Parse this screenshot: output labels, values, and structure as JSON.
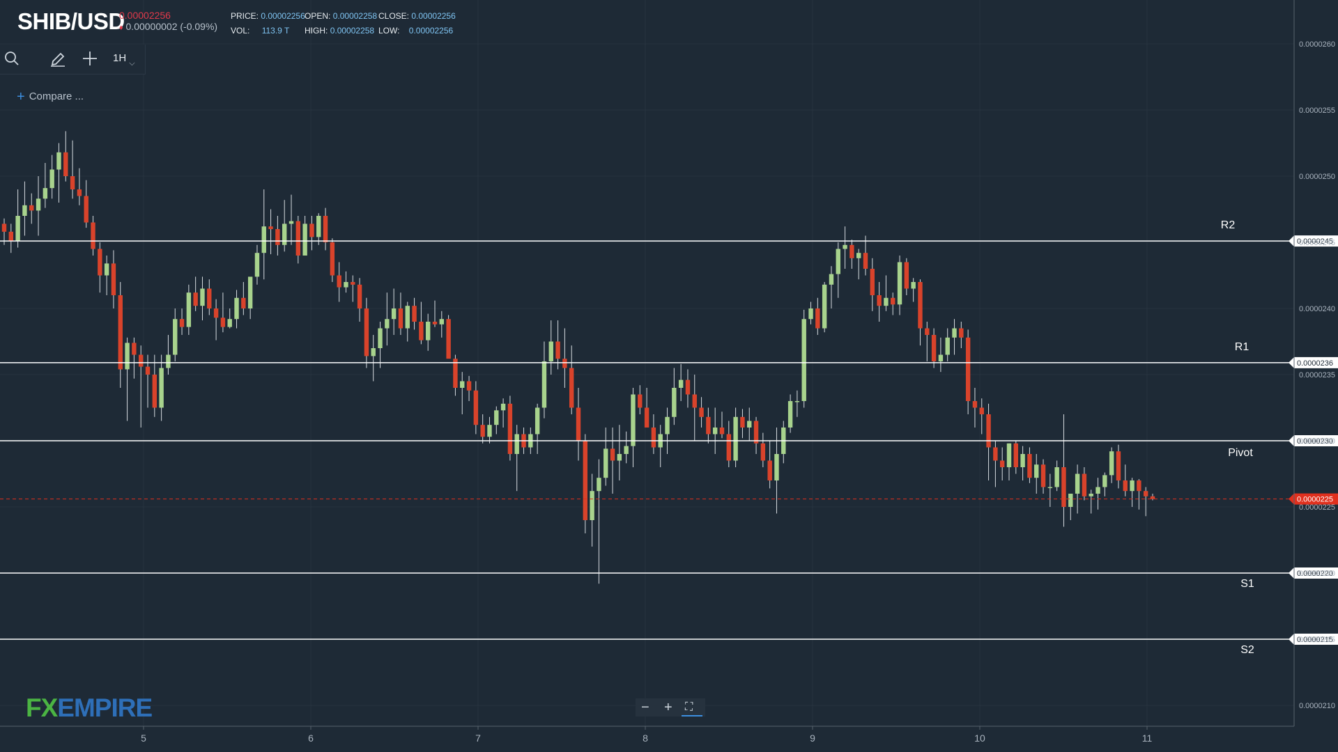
{
  "header": {
    "symbol": "SHIB/USD",
    "last_price": "0.00002256",
    "change_arrow": "♦",
    "change": "0.00000002 (-0.09%)",
    "ohlc": {
      "price_label": "PRICE:",
      "price": "0.00002256",
      "open_label": "OPEN:",
      "open": "0.00002258",
      "close_label": "CLOSE:",
      "close": "0.00002256",
      "vol_label": "VOL:",
      "vol": "113.9 T",
      "high_label": "HIGH:",
      "high": "0.00002258",
      "low_label": "LOW:",
      "low": "0.00002256"
    }
  },
  "toolbar": {
    "icons": [
      "search-icon",
      "pencil-icon",
      "crosshair-icon"
    ],
    "timeframe": "1H",
    "compare_label": "Compare ..."
  },
  "logo": {
    "fx": "FX",
    "empire": "EMPIRE"
  },
  "zoom_controls": {
    "minus": "−",
    "plus": "+",
    "fullscreen": "⛶"
  },
  "colors": {
    "background": "#1e2a36",
    "up": "#a8d38d",
    "down": "#d9432b",
    "level_line": "#ffffff",
    "current_price": "#e0301e",
    "axis_text": "#aab4bf"
  },
  "chart_data": {
    "type": "candlestick",
    "title": "",
    "x_ticks": [
      "5",
      "6",
      "7",
      "8",
      "9",
      "10",
      "11"
    ],
    "y_ticks": [
      "0.0000210",
      "0.0000215",
      "0.0000220",
      "0.0000225",
      "0.0000230",
      "0.0000235",
      "0.0000240",
      "0.0000245",
      "0.0000250",
      "0.0000255",
      "0.0000260"
    ],
    "ylim": [
      2.085e-05,
      2.632e-05
    ],
    "levels": [
      {
        "name": "R2",
        "value": 2.451e-05,
        "label": "0.0000245"
      },
      {
        "name": "R1",
        "value": 2.359e-05,
        "label": "0.0000236"
      },
      {
        "name": "Pivot",
        "value": 2.3e-05,
        "label": "0.0000230"
      },
      {
        "name": "S1",
        "value": 2.2e-05,
        "label": "0.0000220"
      },
      {
        "name": "S2",
        "value": 2.15e-05,
        "label": "0.0000215"
      }
    ],
    "current_price": {
      "value": 2.256e-05,
      "label": "0.0000225"
    },
    "grid": true,
    "candles_ohlc": [
      [
        2.464e-05,
        2.468e-05,
        2.448e-05,
        2.458e-05
      ],
      [
        2.458e-05,
        2.464e-05,
        2.442e-05,
        2.451e-05
      ],
      [
        2.451e-05,
        2.49e-05,
        2.446e-05,
        2.47e-05
      ],
      [
        2.47e-05,
        2.496e-05,
        2.455e-05,
        2.478e-05
      ],
      [
        2.478e-05,
        2.487e-05,
        2.464e-05,
        2.474e-05
      ],
      [
        2.474e-05,
        2.5e-05,
        2.455e-05,
        2.483e-05
      ],
      [
        2.483e-05,
        2.51e-05,
        2.476e-05,
        2.491e-05
      ],
      [
        2.491e-05,
        2.516e-05,
        2.483e-05,
        2.505e-05
      ],
      [
        2.505e-05,
        2.525e-05,
        2.48e-05,
        2.518e-05
      ],
      [
        2.518e-05,
        2.534e-05,
        2.496e-05,
        2.5e-05
      ],
      [
        2.5e-05,
        2.527e-05,
        2.483e-05,
        2.49e-05
      ],
      [
        2.49e-05,
        2.506e-05,
        2.478e-05,
        2.485e-05
      ],
      [
        2.485e-05,
        2.497e-05,
        2.461e-05,
        2.465e-05
      ],
      [
        2.465e-05,
        2.47e-05,
        2.44e-05,
        2.445e-05
      ],
      [
        2.445e-05,
        2.45e-05,
        2.412e-05,
        2.425e-05
      ],
      [
        2.425e-05,
        2.44e-05,
        2.41e-05,
        2.434e-05
      ],
      [
        2.434e-05,
        2.444e-05,
        2.4e-05,
        2.41e-05
      ],
      [
        2.41e-05,
        2.42e-05,
        2.34e-05,
        2.354e-05
      ],
      [
        2.354e-05,
        2.378e-05,
        2.315e-05,
        2.374e-05
      ],
      [
        2.374e-05,
        2.378e-05,
        2.347e-05,
        2.365e-05
      ],
      [
        2.365e-05,
        2.372e-05,
        2.31e-05,
        2.356e-05
      ],
      [
        2.356e-05,
        2.365e-05,
        2.325e-05,
        2.35e-05
      ],
      [
        2.35e-05,
        2.365e-05,
        2.318e-05,
        2.325e-05
      ],
      [
        2.325e-05,
        2.365e-05,
        2.315e-05,
        2.355e-05
      ],
      [
        2.355e-05,
        2.38e-05,
        2.35e-05,
        2.365e-05
      ],
      [
        2.365e-05,
        2.4e-05,
        2.36e-05,
        2.392e-05
      ],
      [
        2.392e-05,
        2.4e-05,
        2.38e-05,
        2.386e-05
      ],
      [
        2.386e-05,
        2.418e-05,
        2.38e-05,
        2.412e-05
      ],
      [
        2.412e-05,
        2.424e-05,
        2.398e-05,
        2.402e-05
      ],
      [
        2.402e-05,
        2.424e-05,
        2.391e-05,
        2.415e-05
      ],
      [
        2.415e-05,
        2.422e-05,
        2.395e-05,
        2.4e-05
      ],
      [
        2.4e-05,
        2.407e-05,
        2.376e-05,
        2.393e-05
      ],
      [
        2.393e-05,
        2.412e-05,
        2.382e-05,
        2.386e-05
      ],
      [
        2.386e-05,
        2.4e-05,
        2.385e-05,
        2.392e-05
      ],
      [
        2.392e-05,
        2.414e-05,
        2.385e-05,
        2.408e-05
      ],
      [
        2.408e-05,
        2.42e-05,
        2.395e-05,
        2.4e-05
      ],
      [
        2.4e-05,
        2.422e-05,
        2.392e-05,
        2.424e-05
      ],
      [
        2.424e-05,
        2.448e-05,
        2.418e-05,
        2.442e-05
      ],
      [
        2.442e-05,
        2.49e-05,
        2.422e-05,
        2.462e-05
      ],
      [
        2.462e-05,
        2.475e-05,
        2.441e-05,
        2.46e-05
      ],
      [
        2.46e-05,
        2.47e-05,
        2.44e-05,
        2.448e-05
      ],
      [
        2.448e-05,
        2.482e-05,
        2.443e-05,
        2.464e-05
      ],
      [
        2.464e-05,
        2.486e-05,
        2.448e-05,
        2.466e-05
      ],
      [
        2.466e-05,
        2.47e-05,
        2.434e-05,
        2.44e-05
      ],
      [
        2.44e-05,
        2.47e-05,
        2.44e-05,
        2.464e-05
      ],
      [
        2.464e-05,
        2.47e-05,
        2.444e-05,
        2.454e-05
      ],
      [
        2.454e-05,
        2.472e-05,
        2.448e-05,
        2.47e-05
      ],
      [
        2.47e-05,
        2.476e-05,
        2.444e-05,
        2.45e-05
      ],
      [
        2.45e-05,
        2.453e-05,
        2.42e-05,
        2.425e-05
      ],
      [
        2.425e-05,
        2.435e-05,
        2.405e-05,
        2.416e-05
      ],
      [
        2.416e-05,
        2.428e-05,
        2.412e-05,
        2.42e-05
      ],
      [
        2.42e-05,
        2.425e-05,
        2.405e-05,
        2.418e-05
      ],
      [
        2.418e-05,
        2.423e-05,
        2.39e-05,
        2.4e-05
      ],
      [
        2.4e-05,
        2.408e-05,
        2.355e-05,
        2.364e-05
      ],
      [
        2.364e-05,
        2.38e-05,
        2.345e-05,
        2.37e-05
      ],
      [
        2.37e-05,
        2.39e-05,
        2.355e-05,
        2.385e-05
      ],
      [
        2.385e-05,
        2.412e-05,
        2.372e-05,
        2.392e-05
      ],
      [
        2.392e-05,
        2.415e-05,
        2.38e-05,
        2.4e-05
      ],
      [
        2.4e-05,
        2.412e-05,
        2.38e-05,
        2.385e-05
      ],
      [
        2.385e-05,
        2.405e-05,
        2.375e-05,
        2.402e-05
      ],
      [
        2.402e-05,
        2.408e-05,
        2.384e-05,
        2.39e-05
      ],
      [
        2.39e-05,
        2.405e-05,
        2.373e-05,
        2.376e-05
      ],
      [
        2.376e-05,
        2.396e-05,
        2.368e-05,
        2.39e-05
      ],
      [
        2.39e-05,
        2.406e-05,
        2.386e-05,
        2.388e-05
      ],
      [
        2.388e-05,
        2.398e-05,
        2.378e-05,
        2.392e-05
      ],
      [
        2.392e-05,
        2.395e-05,
        2.363e-05,
        2.362e-05
      ],
      [
        2.362e-05,
        2.365e-05,
        2.334e-05,
        2.34e-05
      ],
      [
        2.34e-05,
        2.352e-05,
        2.32e-05,
        2.345e-05
      ],
      [
        2.345e-05,
        2.349e-05,
        2.33e-05,
        2.338e-05
      ],
      [
        2.338e-05,
        2.345e-05,
        2.305e-05,
        2.312e-05
      ],
      [
        2.312e-05,
        2.32e-05,
        2.298e-05,
        2.303e-05
      ],
      [
        2.303e-05,
        2.318e-05,
        2.298e-05,
        2.312e-05
      ],
      [
        2.312e-05,
        2.326e-05,
        2.305e-05,
        2.323e-05
      ],
      [
        2.323e-05,
        2.332e-05,
        2.31e-05,
        2.328e-05
      ],
      [
        2.328e-05,
        2.334e-05,
        2.285e-05,
        2.29e-05
      ],
      [
        2.29e-05,
        2.312e-05,
        2.262e-05,
        2.305e-05
      ],
      [
        2.305e-05,
        2.31e-05,
        2.29e-05,
        2.295e-05
      ],
      [
        2.295e-05,
        2.31e-05,
        2.29e-05,
        2.305e-05
      ],
      [
        2.305e-05,
        2.328e-05,
        2.29e-05,
        2.325e-05
      ],
      [
        2.325e-05,
        2.375e-05,
        2.317e-05,
        2.36e-05
      ],
      [
        2.36e-05,
        2.391e-05,
        2.35e-05,
        2.375e-05
      ],
      [
        2.375e-05,
        2.391e-05,
        2.354e-05,
        2.362e-05
      ],
      [
        2.362e-05,
        2.385e-05,
        2.34e-05,
        2.355e-05
      ],
      [
        2.355e-05,
        2.372e-05,
        2.32e-05,
        2.325e-05
      ],
      [
        2.325e-05,
        2.34e-05,
        2.285e-05,
        2.3e-05
      ],
      [
        2.3e-05,
        2.305e-05,
        2.23e-05,
        2.24e-05
      ],
      [
        2.24e-05,
        2.275e-05,
        2.22e-05,
        2.262e-05
      ],
      [
        2.262e-05,
        2.286e-05,
        2.192e-05,
        2.272e-05
      ],
      [
        2.272e-05,
        2.31e-05,
        2.266e-05,
        2.294e-05
      ],
      [
        2.294e-05,
        2.31e-05,
        2.26e-05,
        2.285e-05
      ],
      [
        2.285e-05,
        2.312e-05,
        2.27e-05,
        2.29e-05
      ],
      [
        2.29e-05,
        2.307e-05,
        2.283e-05,
        2.296e-05
      ],
      [
        2.296e-05,
        2.34e-05,
        2.28e-05,
        2.335e-05
      ],
      [
        2.335e-05,
        2.342e-05,
        2.32e-05,
        2.325e-05
      ],
      [
        2.325e-05,
        2.34e-05,
        2.312e-05,
        2.31e-05
      ],
      [
        2.31e-05,
        2.32e-05,
        2.29e-05,
        2.295e-05
      ],
      [
        2.295e-05,
        2.312e-05,
        2.28e-05,
        2.305e-05
      ],
      [
        2.305e-05,
        2.325e-05,
        2.29e-05,
        2.318e-05
      ],
      [
        2.318e-05,
        2.355e-05,
        2.312e-05,
        2.34e-05
      ],
      [
        2.34e-05,
        2.358e-05,
        2.33e-05,
        2.346e-05
      ],
      [
        2.346e-05,
        2.354e-05,
        2.325e-05,
        2.335e-05
      ],
      [
        2.335e-05,
        2.35e-05,
        2.3e-05,
        2.325e-05
      ],
      [
        2.325e-05,
        2.333e-05,
        2.31e-05,
        2.318e-05
      ],
      [
        2.318e-05,
        2.325e-05,
        2.298e-05,
        2.305e-05
      ],
      [
        2.305e-05,
        2.325e-05,
        2.29e-05,
        2.31e-05
      ],
      [
        2.31e-05,
        2.322e-05,
        2.302e-05,
        2.305e-05
      ],
      [
        2.305e-05,
        2.315e-05,
        2.28e-05,
        2.285e-05
      ],
      [
        2.285e-05,
        2.325e-05,
        2.28e-05,
        2.318e-05
      ],
      [
        2.318e-05,
        2.324e-05,
        2.302e-05,
        2.31e-05
      ],
      [
        2.31e-05,
        2.325e-05,
        2.3e-05,
        2.315e-05
      ],
      [
        2.315e-05,
        2.318e-05,
        2.29e-05,
        2.298e-05
      ],
      [
        2.298e-05,
        2.306e-05,
        2.28e-05,
        2.285e-05
      ],
      [
        2.285e-05,
        2.3e-05,
        2.264e-05,
        2.27e-05
      ],
      [
        2.27e-05,
        2.31e-05,
        2.245e-05,
        2.29e-05
      ],
      [
        2.29e-05,
        2.315e-05,
        2.283e-05,
        2.31e-05
      ],
      [
        2.31e-05,
        2.335e-05,
        2.306e-05,
        2.33e-05
      ],
      [
        2.33e-05,
        2.338e-05,
        2.318e-05,
        2.33e-05
      ],
      [
        2.33e-05,
        2.399e-05,
        2.325e-05,
        2.392e-05
      ],
      [
        2.392e-05,
        2.405e-05,
        2.388e-05,
        2.4e-05
      ],
      [
        2.4e-05,
        2.408e-05,
        2.38e-05,
        2.385e-05
      ],
      [
        2.385e-05,
        2.42e-05,
        2.382e-05,
        2.418e-05
      ],
      [
        2.418e-05,
        2.432e-05,
        2.4e-05,
        2.426e-05
      ],
      [
        2.426e-05,
        2.45e-05,
        2.408e-05,
        2.445e-05
      ],
      [
        2.445e-05,
        2.462e-05,
        2.43e-05,
        2.448e-05
      ],
      [
        2.448e-05,
        2.452e-05,
        2.43e-05,
        2.438e-05
      ],
      [
        2.438e-05,
        2.445e-05,
        2.422e-05,
        2.442e-05
      ],
      [
        2.442e-05,
        2.455e-05,
        2.425e-05,
        2.43e-05
      ],
      [
        2.43e-05,
        2.438e-05,
        2.398e-05,
        2.41e-05
      ],
      [
        2.41e-05,
        2.42e-05,
        2.39e-05,
        2.402e-05
      ],
      [
        2.402e-05,
        2.425e-05,
        2.398e-05,
        2.408e-05
      ],
      [
        2.408e-05,
        2.412e-05,
        2.395e-05,
        2.403e-05
      ],
      [
        2.403e-05,
        2.44e-05,
        2.395e-05,
        2.435e-05
      ],
      [
        2.435e-05,
        2.438e-05,
        2.41e-05,
        2.415e-05
      ],
      [
        2.415e-05,
        2.423e-05,
        2.405e-05,
        2.42e-05
      ],
      [
        2.42e-05,
        2.422e-05,
        2.372e-05,
        2.385e-05
      ],
      [
        2.385e-05,
        2.39e-05,
        2.36e-05,
        2.38e-05
      ],
      [
        2.38e-05,
        2.385e-05,
        2.355e-05,
        2.36e-05
      ],
      [
        2.36e-05,
        2.378e-05,
        2.352e-05,
        2.365e-05
      ],
      [
        2.365e-05,
        2.385e-05,
        2.36e-05,
        2.378e-05
      ],
      [
        2.378e-05,
        2.392e-05,
        2.365e-05,
        2.385e-05
      ],
      [
        2.385e-05,
        2.39e-05,
        2.37e-05,
        2.378e-05
      ],
      [
        2.378e-05,
        2.384e-05,
        2.32e-05,
        2.33e-05
      ],
      [
        2.33e-05,
        2.34e-05,
        2.31e-05,
        2.325e-05
      ],
      [
        2.325e-05,
        2.332e-05,
        2.305e-05,
        2.32e-05
      ],
      [
        2.32e-05,
        2.328e-05,
        2.27e-05,
        2.295e-05
      ],
      [
        2.295e-05,
        2.3e-05,
        2.265e-05,
        2.285e-05
      ],
      [
        2.285e-05,
        2.295e-05,
        2.27e-05,
        2.28e-05
      ],
      [
        2.28e-05,
        2.298e-05,
        2.27e-05,
        2.298e-05
      ],
      [
        2.298e-05,
        2.3e-05,
        2.275e-05,
        2.28e-05
      ],
      [
        2.28e-05,
        2.296e-05,
        2.27e-05,
        2.29e-05
      ],
      [
        2.29e-05,
        2.295e-05,
        2.268e-05,
        2.272e-05
      ],
      [
        2.272e-05,
        2.29e-05,
        2.26e-05,
        2.282e-05
      ],
      [
        2.282e-05,
        2.286e-05,
        2.26e-05,
        2.265e-05
      ],
      [
        2.265e-05,
        2.275e-05,
        2.25e-05,
        2.265e-05
      ],
      [
        2.265e-05,
        2.285e-05,
        2.262e-05,
        2.28e-05
      ],
      [
        2.28e-05,
        2.32e-05,
        2.235e-05,
        2.25e-05
      ],
      [
        2.25e-05,
        2.26e-05,
        2.24e-05,
        2.26e-05
      ],
      [
        2.26e-05,
        2.282e-05,
        2.245e-05,
        2.275e-05
      ],
      [
        2.275e-05,
        2.28e-05,
        2.255e-05,
        2.258e-05
      ],
      [
        2.258e-05,
        2.263e-05,
        2.245e-05,
        2.26e-05
      ],
      [
        2.26e-05,
        2.272e-05,
        2.248e-05,
        2.265e-05
      ],
      [
        2.265e-05,
        2.276e-05,
        2.258e-05,
        2.274e-05
      ],
      [
        2.274e-05,
        2.295e-05,
        2.268e-05,
        2.292e-05
      ],
      [
        2.292e-05,
        2.297e-05,
        2.264e-05,
        2.27e-05
      ],
      [
        2.27e-05,
        2.282e-05,
        2.258e-05,
        2.262e-05
      ],
      [
        2.262e-05,
        2.272e-05,
        2.25e-05,
        2.27e-05
      ],
      [
        2.27e-05,
        2.271e-05,
        2.248e-05,
        2.262e-05
      ],
      [
        2.262e-05,
        2.265e-05,
        2.243e-05,
        2.258e-05
      ],
      [
        2.258e-05,
        2.26e-05,
        2.255e-05,
        2.256e-05
      ]
    ]
  }
}
